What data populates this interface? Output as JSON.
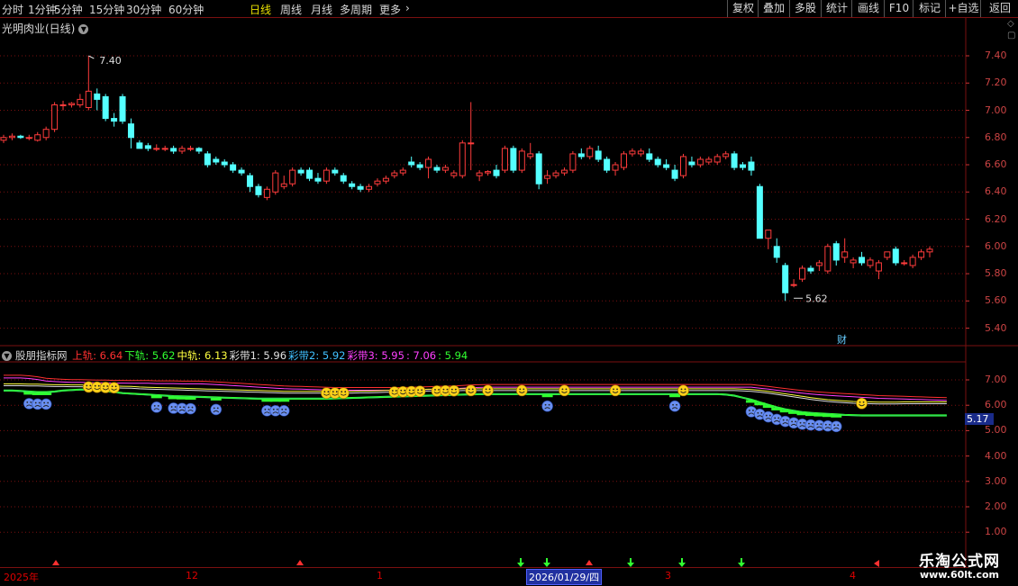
{
  "toolbar": {
    "periods": [
      {
        "label": "分时",
        "active": false
      },
      {
        "label": "1分钟",
        "active": false
      },
      {
        "label": "5分钟",
        "active": false
      },
      {
        "label": "15分钟",
        "active": false
      },
      {
        "label": "30分钟",
        "active": false
      },
      {
        "label": "60分钟",
        "active": false
      },
      {
        "label": "日线",
        "active": true
      },
      {
        "label": "周线",
        "active": false
      },
      {
        "label": "月线",
        "active": false
      },
      {
        "label": "多周期",
        "active": false
      },
      {
        "label": "更多",
        "active": false
      }
    ],
    "tools": [
      "复权",
      "叠加",
      "多股",
      "统计",
      "画线",
      "F10",
      "标记",
      "+自选",
      "返回"
    ]
  },
  "chart": {
    "stock_title": "光明肉业(日线)",
    "high_marker": "7.40",
    "low_marker": "5.62",
    "cai_marker": "财",
    "y_ticks": [
      "7.40",
      "7.20",
      "7.00",
      "6.80",
      "6.60",
      "6.40",
      "6.20",
      "6.00",
      "5.80",
      "5.60",
      "5.40"
    ]
  },
  "indicator": {
    "name": "股朋指标网",
    "items": [
      {
        "label": "上轨: 6.64",
        "color": "#ff3030"
      },
      {
        "label": "下轨: 5.62",
        "color": "#30ff30"
      },
      {
        "label": "中轨: 6.13",
        "color": "#ffff40"
      },
      {
        "label": "彩带1: 5.96",
        "color": "#e0e0e0"
      },
      {
        "label": "彩带2: 5.92",
        "color": "#40c0ff"
      },
      {
        "label": "彩带3: 5.95",
        "color": "#ff40ff"
      },
      {
        "label": ": 7.06",
        "color": "#ff40ff"
      },
      {
        "label": ": 5.94",
        "color": "#30ff30"
      }
    ],
    "y_ticks": [
      "7.00",
      "6.00",
      "5.00",
      "4.00",
      "3.00",
      "2.00",
      "1.00"
    ],
    "current_value": "5.17"
  },
  "date_axis": {
    "labels": [
      "2025年",
      "12",
      "1",
      "3",
      "4"
    ],
    "cursor": "2026/01/29/四"
  },
  "brand": {
    "name": "乐淘公式网",
    "url": "www.60lt.com"
  },
  "colors": {
    "up": "#ff3c3c",
    "down": "#54ffff",
    "grid": "#7a1010"
  },
  "chart_data": {
    "type": "candlestick",
    "candles": [
      [
        6.78,
        6.82,
        6.76,
        6.8
      ],
      [
        6.8,
        6.83,
        6.78,
        6.81
      ],
      [
        6.81,
        6.82,
        6.79,
        6.8
      ],
      [
        6.8,
        6.82,
        6.78,
        6.8
      ],
      [
        6.78,
        6.84,
        6.77,
        6.82
      ],
      [
        6.8,
        6.88,
        6.78,
        6.86
      ],
      [
        6.86,
        7.06,
        6.84,
        7.04
      ],
      [
        7.04,
        7.07,
        7.0,
        7.04
      ],
      [
        7.04,
        7.06,
        7.02,
        7.05
      ],
      [
        7.04,
        7.12,
        7.02,
        7.08
      ],
      [
        7.02,
        7.4,
        7.0,
        7.14
      ],
      [
        7.12,
        7.16,
        7.0,
        7.08
      ],
      [
        7.1,
        7.12,
        6.92,
        6.94
      ],
      [
        6.94,
        6.98,
        6.88,
        6.92
      ],
      [
        7.1,
        7.12,
        6.9,
        6.92
      ],
      [
        6.9,
        6.94,
        6.72,
        6.8
      ],
      [
        6.76,
        6.78,
        6.72,
        6.72
      ],
      [
        6.74,
        6.76,
        6.7,
        6.72
      ],
      [
        6.72,
        6.75,
        6.7,
        6.72
      ],
      [
        6.72,
        6.74,
        6.7,
        6.72
      ],
      [
        6.72,
        6.74,
        6.68,
        6.7
      ],
      [
        6.7,
        6.74,
        6.68,
        6.72
      ],
      [
        6.72,
        6.74,
        6.7,
        6.72
      ],
      [
        6.72,
        6.73,
        6.68,
        6.7
      ],
      [
        6.68,
        6.7,
        6.58,
        6.6
      ],
      [
        6.64,
        6.66,
        6.6,
        6.62
      ],
      [
        6.62,
        6.64,
        6.58,
        6.6
      ],
      [
        6.6,
        6.62,
        6.54,
        6.56
      ],
      [
        6.56,
        6.58,
        6.52,
        6.54
      ],
      [
        6.52,
        6.54,
        6.4,
        6.44
      ],
      [
        6.44,
        6.46,
        6.36,
        6.38
      ],
      [
        6.36,
        6.44,
        6.34,
        6.42
      ],
      [
        6.4,
        6.56,
        6.38,
        6.54
      ],
      [
        6.44,
        6.52,
        6.42,
        6.46
      ],
      [
        6.46,
        6.58,
        6.44,
        6.56
      ],
      [
        6.56,
        6.58,
        6.52,
        6.54
      ],
      [
        6.56,
        6.58,
        6.48,
        6.5
      ],
      [
        6.5,
        6.54,
        6.46,
        6.48
      ],
      [
        6.48,
        6.58,
        6.46,
        6.56
      ],
      [
        6.56,
        6.58,
        6.52,
        6.54
      ],
      [
        6.52,
        6.54,
        6.46,
        6.48
      ],
      [
        6.46,
        6.48,
        6.42,
        6.44
      ],
      [
        6.44,
        6.46,
        6.4,
        6.42
      ],
      [
        6.42,
        6.46,
        6.4,
        6.44
      ],
      [
        6.46,
        6.5,
        6.44,
        6.48
      ],
      [
        6.48,
        6.52,
        6.46,
        6.5
      ],
      [
        6.52,
        6.56,
        6.5,
        6.54
      ],
      [
        6.54,
        6.58,
        6.52,
        6.56
      ],
      [
        6.62,
        6.66,
        6.58,
        6.6
      ],
      [
        6.6,
        6.62,
        6.56,
        6.58
      ],
      [
        6.58,
        6.66,
        6.5,
        6.64
      ],
      [
        6.58,
        6.6,
        6.54,
        6.56
      ],
      [
        6.56,
        6.6,
        6.54,
        6.58
      ],
      [
        6.52,
        6.56,
        6.5,
        6.54
      ],
      [
        6.52,
        6.78,
        6.5,
        6.76
      ],
      [
        6.76,
        7.06,
        6.56,
        6.76
      ],
      [
        6.52,
        6.56,
        6.48,
        6.54
      ],
      [
        6.54,
        6.56,
        6.52,
        6.55
      ],
      [
        6.56,
        6.6,
        6.5,
        6.52
      ],
      [
        6.56,
        6.74,
        6.54,
        6.72
      ],
      [
        6.72,
        6.74,
        6.54,
        6.56
      ],
      [
        6.56,
        6.72,
        6.54,
        6.7
      ],
      [
        6.66,
        6.76,
        6.64,
        6.68
      ],
      [
        6.68,
        6.7,
        6.42,
        6.46
      ],
      [
        6.5,
        6.56,
        6.46,
        6.52
      ],
      [
        6.52,
        6.56,
        6.5,
        6.54
      ],
      [
        6.54,
        6.58,
        6.52,
        6.56
      ],
      [
        6.56,
        6.7,
        6.54,
        6.68
      ],
      [
        6.68,
        6.72,
        6.64,
        6.66
      ],
      [
        6.66,
        6.74,
        6.64,
        6.72
      ],
      [
        6.7,
        6.74,
        6.62,
        6.64
      ],
      [
        6.64,
        6.66,
        6.54,
        6.56
      ],
      [
        6.56,
        6.62,
        6.52,
        6.6
      ],
      [
        6.58,
        6.7,
        6.56,
        6.68
      ],
      [
        6.68,
        6.72,
        6.66,
        6.7
      ],
      [
        6.68,
        6.72,
        6.66,
        6.7
      ],
      [
        6.68,
        6.72,
        6.62,
        6.64
      ],
      [
        6.64,
        6.66,
        6.58,
        6.6
      ],
      [
        6.6,
        6.64,
        6.56,
        6.58
      ],
      [
        6.56,
        6.6,
        6.48,
        6.5
      ],
      [
        6.52,
        6.68,
        6.5,
        6.66
      ],
      [
        6.62,
        6.66,
        6.58,
        6.6
      ],
      [
        6.6,
        6.66,
        6.58,
        6.64
      ],
      [
        6.62,
        6.66,
        6.6,
        6.64
      ],
      [
        6.62,
        6.68,
        6.6,
        6.66
      ],
      [
        6.66,
        6.7,
        6.64,
        6.68
      ],
      [
        6.68,
        6.7,
        6.56,
        6.58
      ],
      [
        6.6,
        6.62,
        6.56,
        6.58
      ],
      [
        6.62,
        6.66,
        6.52,
        6.56
      ],
      [
        6.44,
        6.46,
        6.06,
        6.06
      ],
      [
        6.06,
        6.12,
        5.98,
        6.12
      ],
      [
        6.0,
        6.06,
        5.88,
        5.92
      ],
      [
        5.86,
        5.88,
        5.6,
        5.66
      ],
      [
        5.72,
        5.76,
        5.7,
        5.72
      ],
      [
        5.76,
        5.86,
        5.74,
        5.84
      ],
      [
        5.84,
        5.86,
        5.8,
        5.82
      ],
      [
        5.86,
        5.9,
        5.82,
        5.88
      ],
      [
        5.82,
        6.02,
        5.8,
        6.0
      ],
      [
        6.02,
        6.04,
        5.86,
        5.9
      ],
      [
        5.92,
        6.06,
        5.88,
        5.96
      ],
      [
        5.88,
        5.92,
        5.84,
        5.9
      ],
      [
        5.92,
        5.96,
        5.86,
        5.88
      ],
      [
        5.86,
        5.92,
        5.84,
        5.9
      ],
      [
        5.82,
        5.9,
        5.76,
        5.88
      ],
      [
        5.92,
        5.96,
        5.9,
        5.96
      ],
      [
        5.98,
        6.0,
        5.86,
        5.88
      ],
      [
        5.88,
        5.9,
        5.86,
        5.88
      ],
      [
        5.86,
        5.94,
        5.84,
        5.92
      ],
      [
        5.92,
        5.98,
        5.9,
        5.96
      ],
      [
        5.96,
        6.0,
        5.92,
        5.98
      ]
    ],
    "indicator_lines": {
      "upper": [
        7.18,
        7.18,
        7.18,
        7.16,
        7.12,
        7.06,
        7.04,
        7.02,
        7.01,
        7.01,
        7.0,
        6.99,
        6.99,
        6.98,
        6.98,
        6.97,
        6.97,
        6.97,
        6.96,
        6.96,
        6.96,
        6.95,
        6.95,
        6.95,
        6.94,
        6.92,
        6.9,
        6.88,
        6.86,
        6.84,
        6.82,
        6.8,
        6.78,
        6.76,
        6.75,
        6.74,
        6.73,
        6.72,
        6.71,
        6.7,
        6.7,
        6.7,
        6.7,
        6.7,
        6.7,
        6.7,
        6.7,
        6.7,
        6.71,
        6.72,
        6.73,
        6.74,
        6.75,
        6.76,
        6.78,
        6.8,
        6.81,
        6.82,
        6.82,
        6.82,
        6.82,
        6.82,
        6.82,
        6.82,
        6.82,
        6.82,
        6.82,
        6.82,
        6.82,
        6.82,
        6.82,
        6.82,
        6.82,
        6.82,
        6.82,
        6.82,
        6.82,
        6.82,
        6.82,
        6.82,
        6.82,
        6.82,
        6.82,
        6.82,
        6.82,
        6.82,
        6.82,
        6.82,
        6.82,
        6.78,
        6.74,
        6.7,
        6.66,
        6.62,
        6.58,
        6.55,
        6.52,
        6.5,
        6.48,
        6.46,
        6.44,
        6.42,
        6.4,
        6.38,
        6.37,
        6.36,
        6.35,
        6.34,
        6.33,
        6.32,
        6.31,
        6.3
      ],
      "middle": [
        6.84,
        6.84,
        6.84,
        6.83,
        6.83,
        6.82,
        6.81,
        6.81,
        6.8,
        6.8,
        6.79,
        6.78,
        6.77,
        6.76,
        6.75,
        6.74,
        6.72,
        6.71,
        6.7,
        6.69,
        6.68,
        6.67,
        6.66,
        6.65,
        6.64,
        6.63,
        6.62,
        6.61,
        6.6,
        6.59,
        6.58,
        6.57,
        6.56,
        6.55,
        6.55,
        6.55,
        6.55,
        6.55,
        6.55,
        6.55,
        6.55,
        6.55,
        6.56,
        6.56,
        6.57,
        6.58,
        6.59,
        6.6,
        6.61,
        6.62,
        6.63,
        6.63,
        6.64,
        6.64,
        6.65,
        6.65,
        6.65,
        6.65,
        6.65,
        6.65,
        6.65,
        6.65,
        6.65,
        6.65,
        6.65,
        6.65,
        6.65,
        6.65,
        6.65,
        6.65,
        6.65,
        6.65,
        6.65,
        6.65,
        6.65,
        6.65,
        6.65,
        6.65,
        6.65,
        6.65,
        6.65,
        6.65,
        6.65,
        6.65,
        6.65,
        6.65,
        6.65,
        6.64,
        6.62,
        6.59,
        6.55,
        6.5,
        6.45,
        6.4,
        6.35,
        6.3,
        6.26,
        6.22,
        6.19,
        6.17,
        6.15,
        6.14,
        6.13,
        6.12,
        6.12,
        6.12,
        6.13,
        6.13,
        6.13,
        6.13,
        6.13,
        6.13
      ],
      "lower": [
        6.6,
        6.6,
        6.58,
        6.56,
        6.54,
        6.54,
        6.56,
        6.6,
        6.62,
        6.64,
        6.64,
        6.62,
        6.58,
        6.54,
        6.5,
        6.48,
        6.46,
        6.44,
        6.42,
        6.4,
        6.38,
        6.37,
        6.36,
        6.35,
        6.34,
        6.33,
        6.32,
        6.31,
        6.3,
        6.29,
        6.28,
        6.28,
        6.28,
        6.28,
        6.28,
        6.28,
        6.28,
        6.28,
        6.28,
        6.29,
        6.3,
        6.31,
        6.32,
        6.33,
        6.34,
        6.35,
        6.36,
        6.37,
        6.38,
        6.39,
        6.4,
        6.41,
        6.42,
        6.43,
        6.44,
        6.45,
        6.46,
        6.46,
        6.46,
        6.46,
        6.46,
        6.46,
        6.46,
        6.46,
        6.46,
        6.46,
        6.46,
        6.46,
        6.46,
        6.46,
        6.46,
        6.46,
        6.46,
        6.46,
        6.46,
        6.46,
        6.46,
        6.46,
        6.46,
        6.46,
        6.46,
        6.46,
        6.46,
        6.46,
        6.46,
        6.44,
        6.4,
        6.32,
        6.24,
        6.14,
        6.04,
        5.94,
        5.86,
        5.8,
        5.75,
        5.72,
        5.7,
        5.68,
        5.66,
        5.64,
        5.63,
        5.62,
        5.62,
        5.62,
        5.62,
        5.62,
        5.62,
        5.62,
        5.62,
        5.62,
        5.62,
        5.62
      ]
    }
  }
}
